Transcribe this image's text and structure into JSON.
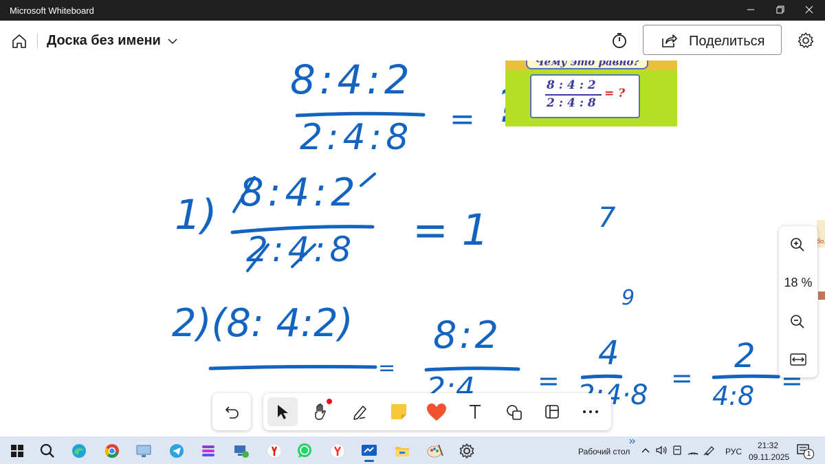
{
  "window": {
    "title": "Microsoft Whiteboard",
    "controls": [
      "minimize-icon",
      "restore-icon",
      "close-icon"
    ]
  },
  "header": {
    "board_title": "Доска без имени",
    "share_label": "Поделиться",
    "icons": [
      "home-icon",
      "chevron-down-icon",
      "timer-icon",
      "share-icon",
      "settings-icon"
    ]
  },
  "canvas": {
    "ink_lines": {
      "top_numerator": "8:4:2",
      "top_denominator": "2:4:8",
      "top_equals": "=",
      "top_question": "?",
      "step1_label": "1)",
      "step1_numerator": "8:4:2",
      "step1_denominator": "2:4:8",
      "step1_result": "= 1",
      "stray_mark_1": "7",
      "step2_label": "2)(8: 4:2)",
      "step2_fraction_numerator": "8:2",
      "step2_fraction_denominator": "2:4",
      "step2_eq_1": "=",
      "step2_eq_2": "=",
      "step2_small_9": "9",
      "step2_four": "4",
      "step2_den_2": "2:4·8",
      "step2_eq_3": "=",
      "step2_two": "2",
      "step2_den_3": "4:8",
      "step2_eq_4": "="
    },
    "image_card": {
      "heading": "Чему это равно?",
      "numerator": "8 : 4 : 2",
      "denominator": "2 : 4 : 8",
      "equals_question": "= ?",
      "colors": {
        "background": "#b5e024",
        "text": "#3a3aa0",
        "accent": "#e01e1e"
      }
    },
    "right_edge_fragment": "бо."
  },
  "zoom": {
    "level": "18 %",
    "icons": [
      "zoom-in-icon",
      "zoom-out-icon",
      "fit-to-screen-icon"
    ]
  },
  "toolbar": {
    "undo_icon": "undo-icon",
    "tools": [
      "select-arrow-icon",
      "hand-pan-icon",
      "pen-icon",
      "sticky-note-icon",
      "reaction-heart-icon",
      "text-icon",
      "shapes-icon",
      "templates-icon",
      "more-icon"
    ],
    "selected_tool": "select-arrow-icon"
  },
  "taskbar": {
    "apps": [
      "windows-start-icon",
      "search-icon",
      "edge-icon",
      "chrome-icon",
      "remote-desktop-icon",
      "telegram-icon",
      "app-stack-icon",
      "network-monitor-icon",
      "yandex-icon",
      "whatsapp-icon",
      "yandex-browser-icon",
      "whiteboard-icon",
      "file-explorer-icon",
      "paint-icon",
      "settings-icon"
    ],
    "desktop_label": "Рабочий стол",
    "language": "РУС",
    "time": "21:32",
    "date": "09.11.2025",
    "notification_count": "1",
    "accent": "#1364c1"
  }
}
